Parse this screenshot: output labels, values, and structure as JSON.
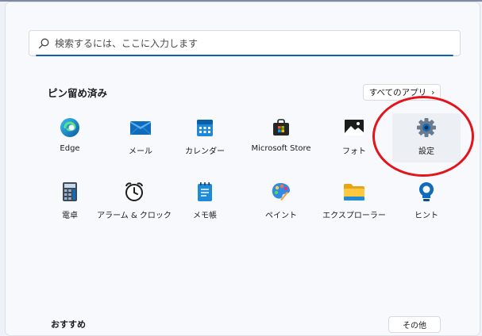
{
  "search": {
    "placeholder": "検索するには、ここに入力します"
  },
  "pinned": {
    "title": "ピン留め済み",
    "all_apps_label": "すべてのアプリ",
    "all_apps_chevron": "›"
  },
  "apps": [
    {
      "label": "Edge",
      "icon": "edge-icon"
    },
    {
      "label": "メール",
      "icon": "mail-icon"
    },
    {
      "label": "カレンダー",
      "icon": "calendar-icon"
    },
    {
      "label": "Microsoft Store",
      "icon": "store-icon"
    },
    {
      "label": "フォト",
      "icon": "photos-icon"
    },
    {
      "label": "設定",
      "icon": "gear-icon"
    },
    {
      "label": "電卓",
      "icon": "calculator-icon"
    },
    {
      "label": "アラーム & クロック",
      "icon": "alarm-clock-icon"
    },
    {
      "label": "メモ帳",
      "icon": "notepad-icon"
    },
    {
      "label": "ペイント",
      "icon": "paint-icon"
    },
    {
      "label": "エクスプローラー",
      "icon": "folder-icon"
    },
    {
      "label": "ヒント",
      "icon": "tips-icon"
    }
  ],
  "recommended": {
    "title": "おすすめ",
    "more_label": "その他"
  },
  "colors": {
    "accent": "#0a5fb4",
    "highlight_circle": "#e3141b"
  }
}
